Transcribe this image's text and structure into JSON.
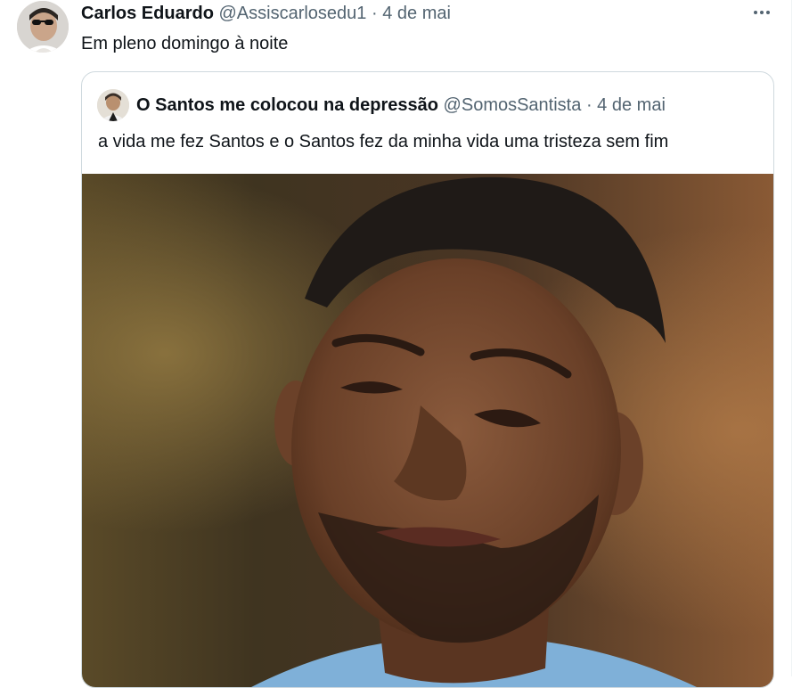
{
  "tweet": {
    "author_name": "Carlos Eduardo",
    "handle": "@Assiscarlosedu1",
    "separator": "·",
    "date": "4 de mai",
    "text": "Em pleno domingo à noite",
    "more_icon": "more-horizontal-icon"
  },
  "quote": {
    "author_name": "O Santos me colocou na depressão",
    "handle": "@SomosSantista",
    "separator": "·",
    "date": "4 de mai",
    "text": "a vida me fez Santos e o Santos fez da minha vida uma tristeza sem fim",
    "media": "photo"
  },
  "colors": {
    "text_primary": "#0f1419",
    "text_secondary": "#536471",
    "border": "#cfd9de"
  }
}
